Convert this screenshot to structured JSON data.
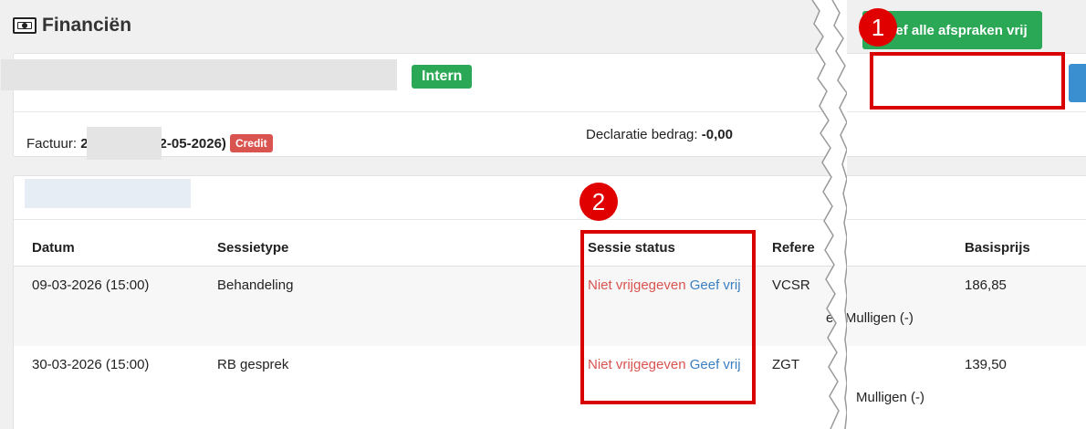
{
  "page": {
    "title": "Financiën",
    "icon": "money-icon"
  },
  "header_card": {
    "badge_intern": "Intern",
    "release_all_button": "Geef alle afspraken vrij",
    "invoice_label": "Factuur:",
    "invoice_prefix": "2",
    "invoice_suffix": "2-05-2026)",
    "credit_badge": "Credit",
    "declaration_label": "Declaratie bedrag:",
    "declaration_value": "-0,00"
  },
  "table": {
    "headers": [
      "Datum",
      "Sessietype",
      "Sessie status",
      "Refere",
      "Basisprijs"
    ],
    "rows": [
      {
        "datum": "09-03-2026 (15:00)",
        "sessietype": "Behandeling",
        "status": "Niet vrijgegeven",
        "action": "Geef vrij",
        "referentie": "VCSR",
        "extra": "en Mulligen (-)",
        "basisprijs": "186,85"
      },
      {
        "datum": "30-03-2026 (15:00)",
        "sessietype": "RB gesprek",
        "status": "Niet vrijgegeven",
        "action": "Geef vrij",
        "referentie": "ZGT",
        "extra": "Mulligen (-)",
        "basisprijs": "139,50"
      }
    ]
  },
  "annotations": {
    "marker1": "1",
    "marker2": "2",
    "color": "#d90000"
  }
}
